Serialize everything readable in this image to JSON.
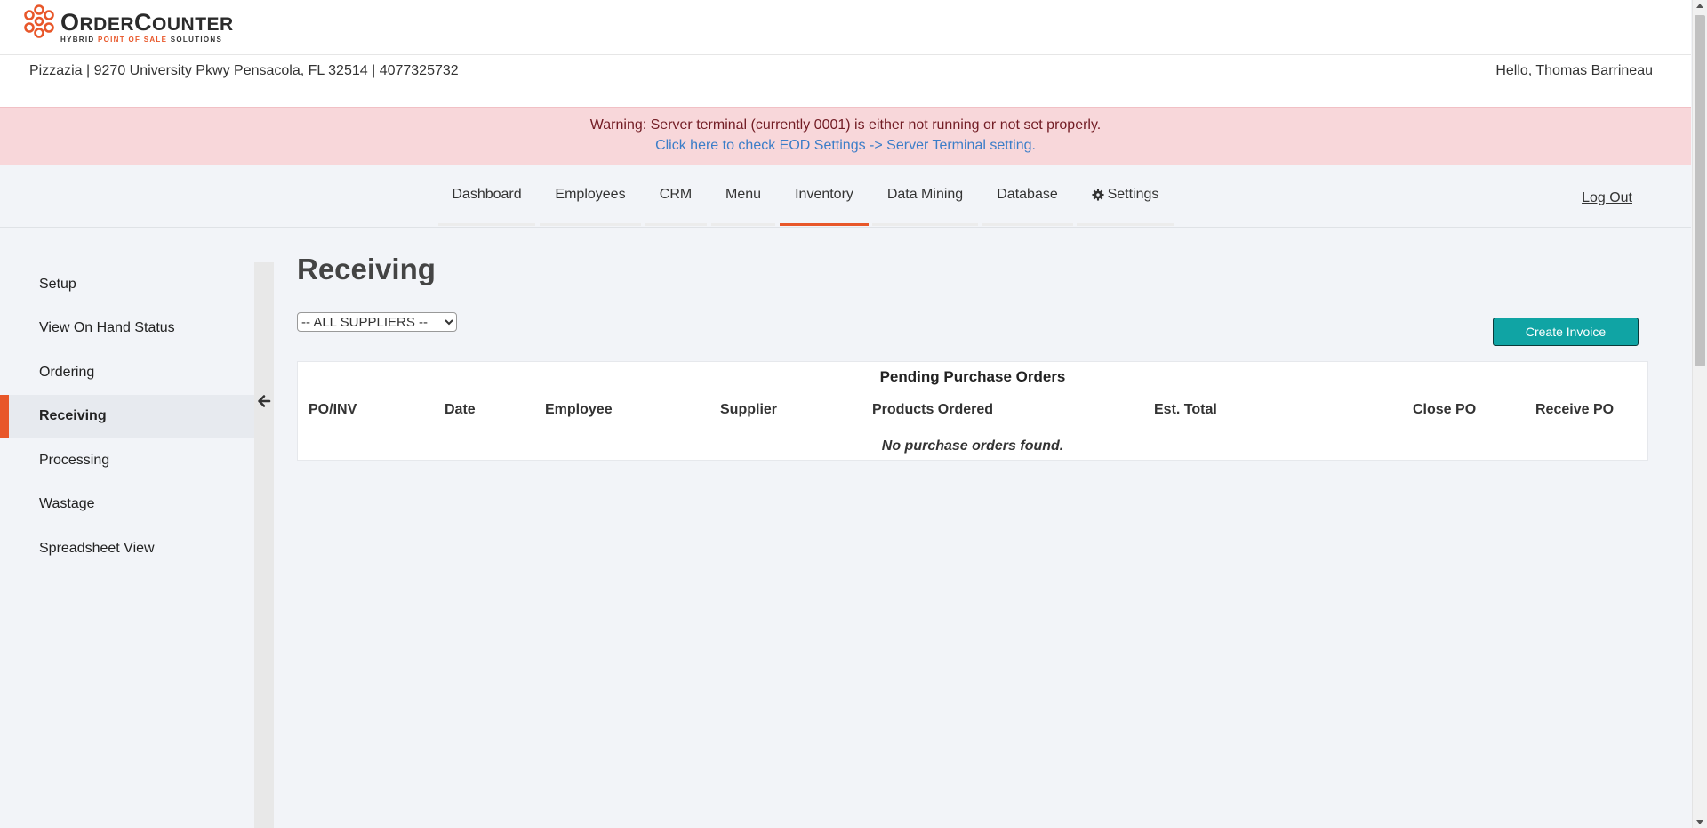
{
  "brand": {
    "name_first_letter": "O",
    "name_rest_1": "RDER",
    "name_second_letter": "C",
    "name_rest_2": "OUNTER",
    "tagline_part1": "HYBRID ",
    "tagline_accent": "POINT OF SALE",
    "tagline_part2": " SOLUTIONS",
    "accent_color": "#e8572a"
  },
  "store": {
    "info": "Pizzazia | 9270 University Pkwy Pensacola, FL 32514 | 4077325732",
    "greeting": "Hello, Thomas Barrineau"
  },
  "alert": {
    "message": "Warning: Server terminal (currently 0001) is either not running or not set properly.",
    "link": "Click here to check EOD Settings -> Server Terminal setting."
  },
  "nav": {
    "items": [
      {
        "label": "Dashboard"
      },
      {
        "label": "Employees"
      },
      {
        "label": "CRM"
      },
      {
        "label": "Menu"
      },
      {
        "label": "Inventory",
        "active": true
      },
      {
        "label": "Data Mining"
      },
      {
        "label": "Database"
      },
      {
        "label": "Settings",
        "icon": "gear-icon"
      }
    ],
    "logout": "Log Out"
  },
  "sidebar": {
    "items": [
      {
        "label": "Setup"
      },
      {
        "label": "View On Hand Status"
      },
      {
        "label": "Ordering"
      },
      {
        "label": "Receiving",
        "active": true
      },
      {
        "label": "Processing"
      },
      {
        "label": "Wastage"
      },
      {
        "label": "Spreadsheet View"
      }
    ],
    "collapse_icon": "arrow-left-icon"
  },
  "main": {
    "title": "Receiving",
    "supplier_select": {
      "selected": "-- ALL SUPPLIERS --"
    },
    "create_button": "Create Invoice",
    "table": {
      "title": "Pending Purchase Orders",
      "columns": [
        "PO/INV",
        "Date",
        "Employee",
        "Supplier",
        "Products Ordered",
        "Est. Total",
        "Close PO",
        "Receive PO"
      ],
      "empty_message": "No purchase orders found."
    }
  },
  "colors": {
    "accent": "#e8572a",
    "button": "#10a4a4",
    "alert_bg": "#f8d7da",
    "alert_text": "#721c24",
    "link": "#3b7dc8"
  }
}
